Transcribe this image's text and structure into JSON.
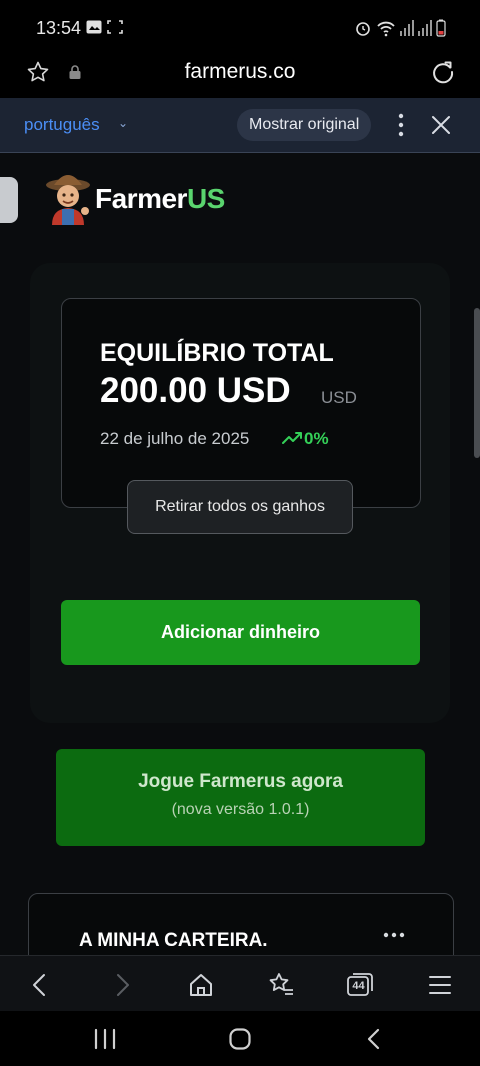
{
  "status_bar": {
    "time": "13:54",
    "icons": [
      "gallery-icon",
      "screenshot-icon",
      "alarm-icon",
      "wifi-icon",
      "signal-icon",
      "signal-icon",
      "battery-icon"
    ]
  },
  "browser": {
    "url": "farmerus.co",
    "icons": [
      "star-icon",
      "lock-icon",
      "reload-icon"
    ]
  },
  "translate_bar": {
    "language": "português",
    "show_original": "Mostrar original"
  },
  "site": {
    "brand_part1": "Farmer",
    "brand_part2": "US",
    "brand_accent": "#5ad46e"
  },
  "balance_card": {
    "title": "EQUILÍBRIO TOTAL",
    "amount": "200.00 USD",
    "currency": "USD",
    "date": "22 de julho de 2025",
    "trend": "0%",
    "trend_color": "#34d058"
  },
  "tooltip": {
    "text": "Retirar todos os ganhos"
  },
  "buttons": {
    "add_money": "Adicionar dinheiro",
    "play_line1": "Jogue Farmerus agora",
    "play_line2": "(nova versão 1.0.1)",
    "add_color": "#18981d",
    "play_color": "#0c6b10"
  },
  "wallet": {
    "title": "A MINHA CARTEIRA."
  },
  "browser_nav": {
    "tabs_count": "44",
    "icons": [
      "back-icon",
      "forward-icon",
      "home-icon",
      "bookmarks-icon",
      "tabs-icon",
      "menu-icon"
    ]
  },
  "system_nav": {
    "icons": [
      "recents-icon",
      "home-circle-icon",
      "system-back-icon"
    ]
  }
}
